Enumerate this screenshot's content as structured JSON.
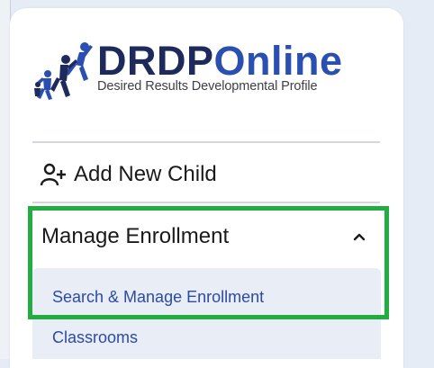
{
  "logo": {
    "brand_drdp": "DRDP",
    "brand_online": "Online",
    "subtitle": "Desired Results Developmental Profile"
  },
  "nav": {
    "add_child": {
      "label": "Add New Child",
      "icon": "add-person-icon"
    },
    "manage_enrollment": {
      "label": "Manage Enrollment",
      "icon": "chevron-up-icon",
      "expanded": true
    },
    "submenu": [
      {
        "label": "Search & Manage Enrollment"
      },
      {
        "label": "Classrooms"
      }
    ]
  },
  "colors": {
    "brand_dark": "#1e2a5c",
    "brand_blue": "#2a4fb0",
    "link": "#2c4aa6",
    "highlight": "#21ad3f",
    "submenu_bg": "#e8edf6"
  }
}
